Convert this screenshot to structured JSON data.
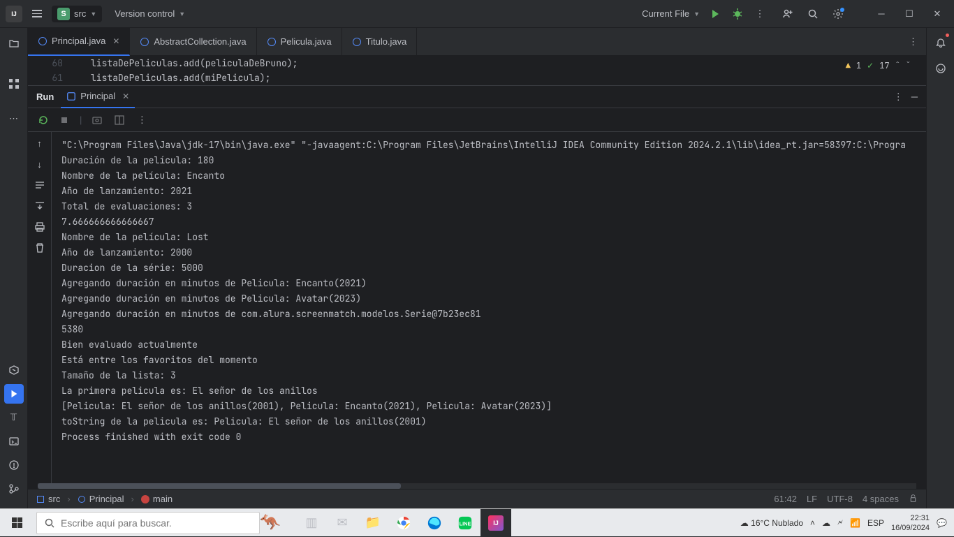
{
  "titlebar": {
    "project_badge": "S",
    "project_name": "src",
    "vcs_label": "Version control",
    "run_config": "Current File"
  },
  "tabs": [
    {
      "name": "Principal.java",
      "active": true,
      "closeable": true
    },
    {
      "name": "AbstractCollection.java",
      "active": false,
      "closeable": false
    },
    {
      "name": "Pelicula.java",
      "active": false,
      "closeable": false
    },
    {
      "name": "Titulo.java",
      "active": false,
      "closeable": false
    }
  ],
  "editor": {
    "lines": [
      {
        "num": "60",
        "code": "            listaDePeliculas.add(peliculaDeBruno);"
      },
      {
        "num": "61",
        "code": "            listaDePeliculas.add(miPelicula);"
      }
    ],
    "warnings": "1",
    "checks": "17"
  },
  "run_panel": {
    "title": "Run",
    "tab_name": "Principal",
    "console_lines": [
      "\"C:\\Program Files\\Java\\jdk-17\\bin\\java.exe\" \"-javaagent:C:\\Program Files\\JetBrains\\IntelliJ IDEA Community Edition 2024.2.1\\lib\\idea_rt.jar=58397:C:\\Progra",
      "Duración de la película: 180",
      "Nombre de la película: Encanto",
      "Año de lanzamiento: 2021",
      "Total de evaluaciones: 3",
      "7.666666666666667",
      "Nombre de la película: Lost",
      "Año de lanzamiento: 2000",
      "Duracion de la série: 5000",
      "Agregando duración en minutos de Pelicula: Encanto(2021)",
      "Agregando duración en minutos de Pelicula: Avatar(2023)",
      "Agregando duración en minutos de com.alura.screenmatch.modelos.Serie@7b23ec81",
      "5380",
      "Bien evaluado actualmente",
      "Está entre los favoritos del momento",
      "Tamaño de la lista: 3",
      "La primera pelicula es: El señor de los anillos",
      "[Pelicula: El señor de los anillos(2001), Pelicula: Encanto(2021), Pelicula: Avatar(2023)]",
      "toString de la pelicula es: Pelicula: El señor de los anillos(2001)",
      "Process finished with exit code 0"
    ]
  },
  "breadcrumb": {
    "root": "src",
    "class": "Principal",
    "method": "main"
  },
  "status": {
    "caret": "61:42",
    "line_sep": "LF",
    "encoding": "UTF-8",
    "indent": "4 spaces"
  },
  "taskbar": {
    "search_placeholder": "Escribe aquí para buscar.",
    "weather": "16°C  Nublado",
    "lang": "ESP",
    "time": "22:31",
    "date": "16/09/2024"
  }
}
